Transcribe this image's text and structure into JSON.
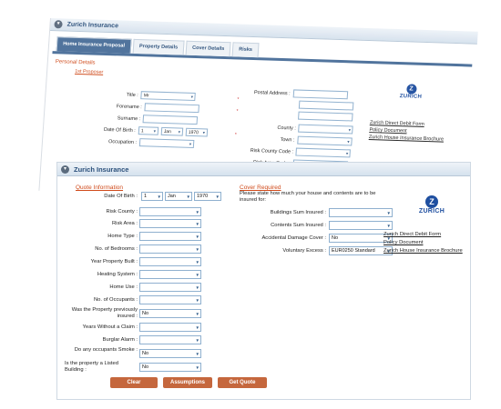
{
  "back": {
    "title": "Zurich Insurance",
    "tabs": [
      "Home Insurance Proposal",
      "Property Details",
      "Cover Details",
      "Risks"
    ],
    "section": "Personal Details",
    "subsection": "1st Proposer",
    "fields": {
      "title_label": "Title :",
      "title_value": "Mr",
      "forename_label": "Forename :",
      "surname_label": "Surname :",
      "dob_label": "Date Of Birth :",
      "dob_day": "1",
      "dob_month": "Jan",
      "dob_year": "1970",
      "occupation_label": "Occupation :",
      "postal_label": "Postal Address :",
      "county_label": "County :",
      "town_label": "Town :",
      "risk_county_code_label": "Risk County Code :",
      "risk_area_code_label": "Risk Area Code :"
    },
    "links": [
      "Zurich Direct Debit Form",
      "Policy Document",
      "Zurich House Insurance Brochure"
    ],
    "logo_text": "ZURICH"
  },
  "front": {
    "title": "Zurich Insurance",
    "quote_title": "Quote Information",
    "cover_title": "Cover Required",
    "cover_prompt": "Please state how much your house and contents are to be insured for:",
    "dob": {
      "label": "Date Of Birth :",
      "day": "1",
      "month": "Jan",
      "year": "1970"
    },
    "left_fields": [
      {
        "label": "Risk County :",
        "value": ""
      },
      {
        "label": "Risk Area :",
        "value": ""
      },
      {
        "label": "Home Type :",
        "value": ""
      },
      {
        "label": "No. of Bedrooms :",
        "value": ""
      },
      {
        "label": "Year Property Built :",
        "value": ""
      },
      {
        "label": "Heating System :",
        "value": ""
      },
      {
        "label": "Home Use :",
        "value": ""
      },
      {
        "label": "No. of Occupants :",
        "value": ""
      },
      {
        "label": "Was the Property previously insured :",
        "value": "No"
      },
      {
        "label": "Years Without a Claim :",
        "value": ""
      },
      {
        "label": "Burglar Alarm :",
        "value": ""
      },
      {
        "label": "Do any occupants Smoke :",
        "value": "No"
      },
      {
        "label": "Is the property a Listed Building :",
        "value": "No"
      }
    ],
    "right_fields": [
      {
        "label": "Buildings Sum Insured :",
        "value": ""
      },
      {
        "label": "Contents Sum Insured :",
        "value": ""
      },
      {
        "label": "Accidental Damage Cover :",
        "value": "No"
      },
      {
        "label": "Voluntary Excess :",
        "value": "EUR0250 Standard"
      }
    ],
    "links": [
      "Zurich Direct Debit Form",
      "Policy Document",
      "Zurich House Insurance Brochure"
    ],
    "logo_text": "ZURICH",
    "buttons": {
      "clear": "Clear",
      "assumptions": "Assumptions",
      "get_quote": "Get Quote"
    }
  }
}
